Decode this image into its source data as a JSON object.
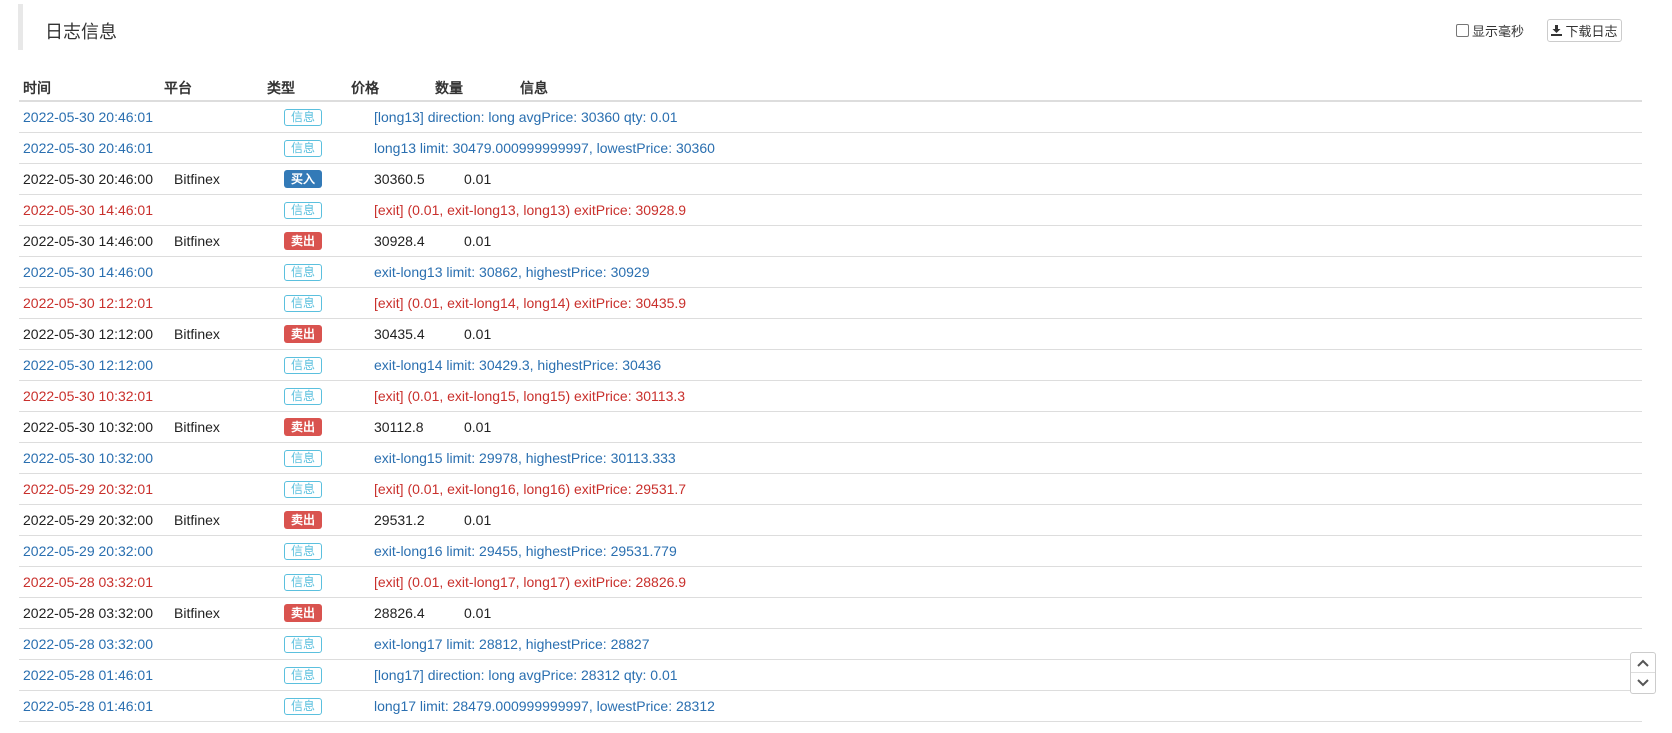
{
  "panel": {
    "title": "日志信息"
  },
  "toolbar": {
    "show_ms_label": "显示毫秒",
    "download_label": "下载日志"
  },
  "table": {
    "headers": {
      "time": "时间",
      "platform": "平台",
      "type": "类型",
      "price": "价格",
      "qty": "数量",
      "info": "信息"
    },
    "rows": [
      {
        "kind": "info",
        "time": "2022-05-30 20:46:01",
        "platform": "",
        "type": "信息",
        "price": "",
        "qty": "",
        "info": "[long13] direction: long avgPrice: 30360 qty: 0.01"
      },
      {
        "kind": "info",
        "time": "2022-05-30 20:46:01",
        "platform": "",
        "type": "信息",
        "price": "",
        "qty": "",
        "info": "long13 limit: 30479.000999999997, lowestPrice: 30360"
      },
      {
        "kind": "buy",
        "time": "2022-05-30 20:46:00",
        "platform": "Bitfinex",
        "type": "买入",
        "price": "30360.5",
        "qty": "0.01",
        "info": ""
      },
      {
        "kind": "exit",
        "time": "2022-05-30 14:46:01",
        "platform": "",
        "type": "信息",
        "price": "",
        "qty": "",
        "info": "[exit] (0.01, exit-long13, long13) exitPrice: 30928.9"
      },
      {
        "kind": "sell",
        "time": "2022-05-30 14:46:00",
        "platform": "Bitfinex",
        "type": "卖出",
        "price": "30928.4",
        "qty": "0.01",
        "info": ""
      },
      {
        "kind": "info",
        "time": "2022-05-30 14:46:00",
        "platform": "",
        "type": "信息",
        "price": "",
        "qty": "",
        "info": "exit-long13 limit: 30862, highestPrice: 30929"
      },
      {
        "kind": "exit",
        "time": "2022-05-30 12:12:01",
        "platform": "",
        "type": "信息",
        "price": "",
        "qty": "",
        "info": "[exit] (0.01, exit-long14, long14) exitPrice: 30435.9"
      },
      {
        "kind": "sell",
        "time": "2022-05-30 12:12:00",
        "platform": "Bitfinex",
        "type": "卖出",
        "price": "30435.4",
        "qty": "0.01",
        "info": ""
      },
      {
        "kind": "info",
        "time": "2022-05-30 12:12:00",
        "platform": "",
        "type": "信息",
        "price": "",
        "qty": "",
        "info": "exit-long14 limit: 30429.3, highestPrice: 30436"
      },
      {
        "kind": "exit",
        "time": "2022-05-30 10:32:01",
        "platform": "",
        "type": "信息",
        "price": "",
        "qty": "",
        "info": "[exit] (0.01, exit-long15, long15) exitPrice: 30113.3"
      },
      {
        "kind": "sell",
        "time": "2022-05-30 10:32:00",
        "platform": "Bitfinex",
        "type": "卖出",
        "price": "30112.8",
        "qty": "0.01",
        "info": ""
      },
      {
        "kind": "info",
        "time": "2022-05-30 10:32:00",
        "platform": "",
        "type": "信息",
        "price": "",
        "qty": "",
        "info": "exit-long15 limit: 29978, highestPrice: 30113.333"
      },
      {
        "kind": "exit",
        "time": "2022-05-29 20:32:01",
        "platform": "",
        "type": "信息",
        "price": "",
        "qty": "",
        "info": "[exit] (0.01, exit-long16, long16) exitPrice: 29531.7"
      },
      {
        "kind": "sell",
        "time": "2022-05-29 20:32:00",
        "platform": "Bitfinex",
        "type": "卖出",
        "price": "29531.2",
        "qty": "0.01",
        "info": ""
      },
      {
        "kind": "info",
        "time": "2022-05-29 20:32:00",
        "platform": "",
        "type": "信息",
        "price": "",
        "qty": "",
        "info": "exit-long16 limit: 29455, highestPrice: 29531.779"
      },
      {
        "kind": "exit",
        "time": "2022-05-28 03:32:01",
        "platform": "",
        "type": "信息",
        "price": "",
        "qty": "",
        "info": "[exit] (0.01, exit-long17, long17) exitPrice: 28826.9"
      },
      {
        "kind": "sell",
        "time": "2022-05-28 03:32:00",
        "platform": "Bitfinex",
        "type": "卖出",
        "price": "28826.4",
        "qty": "0.01",
        "info": ""
      },
      {
        "kind": "info",
        "time": "2022-05-28 03:32:00",
        "platform": "",
        "type": "信息",
        "price": "",
        "qty": "",
        "info": "exit-long17 limit: 28812, highestPrice: 28827"
      },
      {
        "kind": "info",
        "time": "2022-05-28 01:46:01",
        "platform": "",
        "type": "信息",
        "price": "",
        "qty": "",
        "info": "[long17] direction: long avgPrice: 28312 qty: 0.01"
      },
      {
        "kind": "info",
        "time": "2022-05-28 01:46:01",
        "platform": "",
        "type": "信息",
        "price": "",
        "qty": "",
        "info": "long17 limit: 28479.000999999997, lowestPrice: 28312"
      }
    ]
  },
  "colors": {
    "info_text": "#2a6fb0",
    "exit_text": "#c9302c",
    "buy_badge": "#337ab7",
    "sell_badge": "#d9534f",
    "info_badge": "#5bc0de"
  }
}
